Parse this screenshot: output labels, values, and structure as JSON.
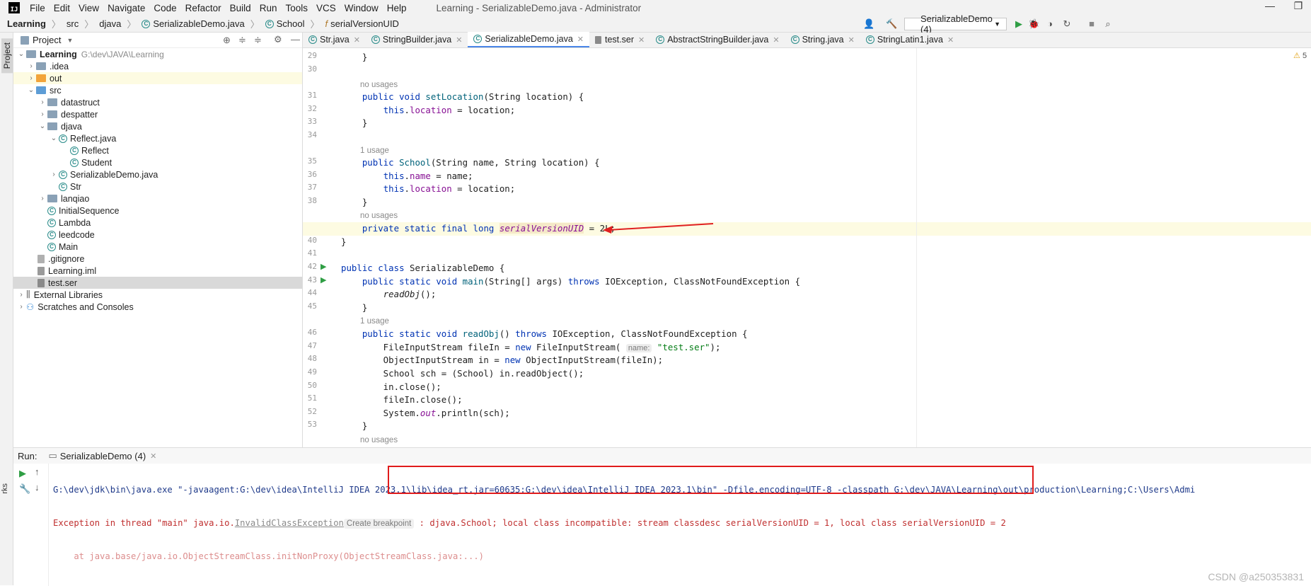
{
  "menu": {
    "items": [
      "File",
      "Edit",
      "View",
      "Navigate",
      "Code",
      "Refactor",
      "Build",
      "Run",
      "Tools",
      "VCS",
      "Window",
      "Help"
    ],
    "window_title": "Learning - SerializableDemo.java - Administrator"
  },
  "breadcrumb": [
    "Learning",
    "src",
    "djava",
    "SerializableDemo.java",
    "School",
    "serialVersionUID"
  ],
  "run_config": "SerializableDemo (4)",
  "side_strip": {
    "project_label": "Project"
  },
  "project": {
    "header": "Project",
    "root_name": "Learning",
    "root_path": "G:\\dev\\JAVA\\Learning",
    "items": [
      ".idea",
      "out",
      "src",
      "datastruct",
      "despatter",
      "djava",
      "Reflect.java",
      "Reflect",
      "Student",
      "SerializableDemo.java",
      "Str",
      "lanqiao",
      "InitialSequence",
      "Lambda",
      "leedcode",
      "Main",
      ".gitignore",
      "Learning.iml",
      "test.ser",
      "External Libraries",
      "Scratches and Consoles"
    ]
  },
  "tabs": [
    "Str.java",
    "StringBuilder.java",
    "SerializableDemo.java",
    "test.ser",
    "AbstractStringBuilder.java",
    "String.java",
    "StringLatin1.java"
  ],
  "editor": {
    "warnings": "5",
    "line_numbers": [
      "29",
      "30",
      "31",
      "32",
      "33",
      "34",
      "35",
      "36",
      "37",
      "38",
      "39",
      "40",
      "41",
      "42",
      "43",
      "44",
      "45",
      "46",
      "47",
      "48",
      "49",
      "50",
      "51",
      "52",
      "53"
    ],
    "usages": {
      "no": "no usages",
      "one": "1 usage"
    },
    "hint_name": "name:",
    "tokens": {
      "public": "public",
      "void": "void",
      "private": "private",
      "static": "static",
      "final": "final",
      "long": "long",
      "class": "class",
      "this": "this",
      "new": "new",
      "throws": "throws",
      "setLocation": "setLocation",
      "School": "School",
      "location": "location",
      "name": "name",
      "serialVersionUID": "serialVersionUID",
      "SerializableDemo": "SerializableDemo",
      "main": "main",
      "readObj": "readObj",
      "out": "out",
      "str_testser": "\"test.ser\""
    },
    "lines": {
      "l29": "    }",
      "l31_a": "(String location) {",
      "l32_b": " = location;",
      "l33": "    }",
      "l35_a": "(String name, String location) {",
      "l36_b": " = name;",
      "l37_b": " = location;",
      "l38": "    }",
      "l39_num": " = 2",
      "l39_end": "L;",
      "l40": "}",
      "l43_a": "(String[] args) ",
      "l43_b": " IOException, ClassNotFoundException {",
      "l44_b": "();",
      "l45": "    }",
      "l46_a": "() ",
      "l46_b": " IOException, ClassNotFoundException {",
      "l47_a": "        FileInputStream fileIn = ",
      "l47_b": " FileInputStream( ",
      "l47_c": ");",
      "l48_a": "        ObjectInputStream in = ",
      "l48_b": " ObjectInputStream(fileIn);",
      "l49": "        School sch = (School) in.readObject();",
      "l50": "        in.close();",
      "l51": "        fileIn.close();",
      "l52_a": "        System.",
      "l52_b": ".println(sch);",
      "l53": "    }"
    }
  },
  "run": {
    "label": "Run:",
    "tab": "SerializableDemo (4)",
    "console_line1": "G:\\dev\\jdk\\bin\\java.exe \"-javaagent:G:\\dev\\idea\\IntelliJ IDEA 2023.1\\lib\\idea_rt.jar=60635:G:\\dev\\idea\\IntelliJ IDEA 2023.1\\bin\" -Dfile.encoding=UTF-8 -classpath G:\\dev\\JAVA\\Learning\\out\\production\\Learning;C:\\Users\\Admi",
    "console_line2_a": "Exception in thread \"main\" java.io.",
    "console_line2_link": "InvalidClassException",
    "console_line2_tip": "Create breakpoint",
    "console_line2_b": " : djava.School; local class incompatible: stream classdesc serialVersionUID = 1, local class serialVersionUID = 2",
    "console_line3": "    at java.base/java.io.ObjectStreamClass.initNonProxy(ObjectStreamClass.java:...)",
    "side_label": "rks"
  },
  "watermark": "CSDN @a250353831",
  "colors": {
    "keyword": "#0033b3",
    "field": "#871094",
    "method": "#00627a",
    "string": "#067d17",
    "error": "#c03030",
    "arrow": "#e02020"
  }
}
